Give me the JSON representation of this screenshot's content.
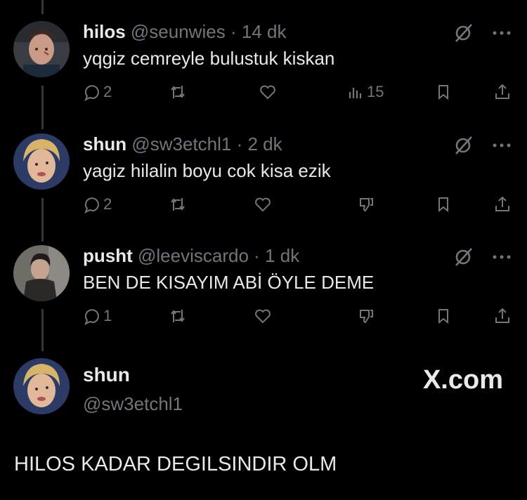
{
  "tweets": [
    {
      "name": "hilos",
      "handle": "@seunwies",
      "sep": "·",
      "time": "14 dk",
      "text": "yqgiz cemreyle bulustuk kiskan",
      "reply_count": "2",
      "views": "15"
    },
    {
      "name": "shun",
      "handle": "@sw3etchl1",
      "sep": "·",
      "time": "2 dk",
      "text": "yagiz hilalin boyu cok kisa ezik",
      "reply_count": "2"
    },
    {
      "name": "pusht",
      "handle": "@leeviscardo",
      "sep": "·",
      "time": "1 dk",
      "text": "BEN DE KISAYIM ABİ ÖYLE DEME",
      "reply_count": "1"
    }
  ],
  "quote": {
    "name": "shun",
    "handle": "@sw3etchl1",
    "site": "X.com",
    "text": "HILOS KADAR DEGILSINDIR OLM"
  },
  "colors": {
    "background": "#000000",
    "text": "#e7e9ea",
    "muted": "#71767b",
    "thread": "#333639"
  }
}
